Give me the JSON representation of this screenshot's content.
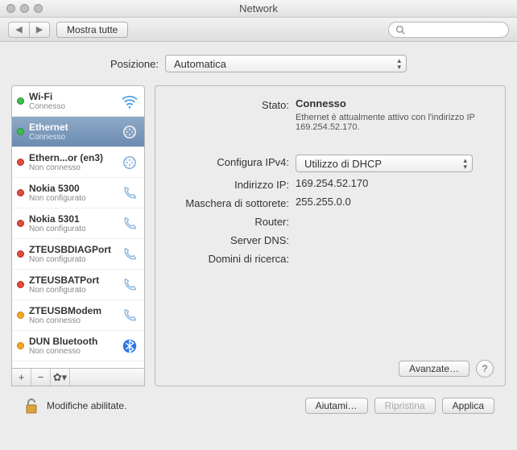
{
  "window": {
    "title": "Network"
  },
  "toolbar": {
    "show_all": "Mostra tutte",
    "search_placeholder": ""
  },
  "location": {
    "label": "Posizione:",
    "value": "Automatica"
  },
  "sidebar": {
    "items": [
      {
        "name": "Wi-Fi",
        "status": "Connesso",
        "dot": "green",
        "icon": "wifi"
      },
      {
        "name": "Ethernet",
        "status": "Connesso",
        "dot": "green",
        "icon": "ethernet",
        "selected": true
      },
      {
        "name": "Ethern...or (en3)",
        "status": "Non connesso",
        "dot": "red",
        "icon": "ethernet"
      },
      {
        "name": "Nokia 5300",
        "status": "Non configurato",
        "dot": "red",
        "icon": "phone"
      },
      {
        "name": "Nokia 5301",
        "status": "Non configurato",
        "dot": "red",
        "icon": "phone"
      },
      {
        "name": "ZTEUSBDIAGPort",
        "status": "Non configurato",
        "dot": "red",
        "icon": "phone"
      },
      {
        "name": "ZTEUSBATPort",
        "status": "Non configurato",
        "dot": "red",
        "icon": "phone"
      },
      {
        "name": "ZTEUSBModem",
        "status": "Non connesso",
        "dot": "orange",
        "icon": "phone"
      },
      {
        "name": "DUN Bluetooth",
        "status": "Non connesso",
        "dot": "orange",
        "icon": "bluetooth"
      }
    ]
  },
  "detail": {
    "status_label": "Stato:",
    "status_value": "Connesso",
    "status_desc": "Ethernet è attualmente attivo con l'indirizzo IP 169.254.52.170.",
    "configure_label": "Configura IPv4:",
    "configure_value": "Utilizzo di DHCP",
    "ip_label": "Indirizzo IP:",
    "ip_value": "169.254.52.170",
    "mask_label": "Maschera di sottorete:",
    "mask_value": "255.255.0.0",
    "router_label": "Router:",
    "router_value": "",
    "dns_label": "Server DNS:",
    "dns_value": "",
    "search_label": "Domini di ricerca:",
    "search_value": "",
    "advanced": "Avanzate…"
  },
  "footer": {
    "lock_text": "Modifiche abilitate.",
    "help_me": "Aiutami…",
    "revert": "Ripristina",
    "apply": "Applica"
  }
}
